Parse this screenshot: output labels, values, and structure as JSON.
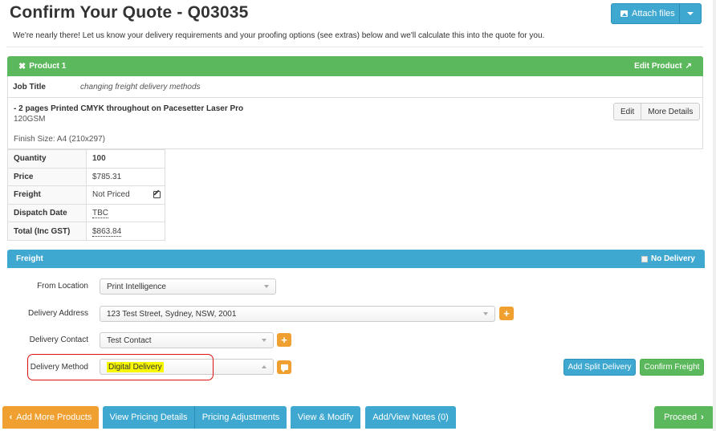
{
  "page": {
    "title": "Confirm Your Quote - Q03035",
    "intro": "We're nearly there! Let us know your delivery requirements and your proofing options (see extras) below and we'll calculate this into the quote for you.",
    "attach_label": "Attach files"
  },
  "product": {
    "header": "Product 1",
    "edit_label": "Edit Product",
    "job_title_label": "Job Title",
    "job_title_value": "changing freight delivery methods",
    "spec_title": "- 2 pages Printed CMYK throughout on Pacesetter Laser Pro",
    "spec_gsm": "120GSM",
    "finish_size": "Finish Size: A4 (210x297)",
    "edit_button": "Edit",
    "more_details_button": "More Details"
  },
  "summary": {
    "rows": [
      {
        "label": "Quantity",
        "value": "100"
      },
      {
        "label": "Price",
        "value": "$785.31"
      },
      {
        "label": "Freight",
        "value": "Not Priced"
      },
      {
        "label": "Dispatch Date",
        "value": "TBC"
      },
      {
        "label": "Total (Inc GST)",
        "value": "$863.84"
      }
    ]
  },
  "freight": {
    "header": "Freight",
    "no_delivery_label": "No Delivery",
    "from_location_label": "From Location",
    "from_location_value": "Print Intelligence",
    "delivery_address_label": "Delivery Address",
    "delivery_address_value": "123 Test Street, Sydney, NSW, 2001",
    "delivery_contact_label": "Delivery Contact",
    "delivery_contact_value": "Test Contact",
    "delivery_method_label": "Delivery Method",
    "delivery_method_value": "Digital Delivery",
    "add_split_label": "Add Split Delivery",
    "confirm_label": "Confirm Freight"
  },
  "footer": {
    "add_more_products": "Add More Products",
    "view_pricing_details": "View Pricing Details",
    "pricing_adjustments": "Pricing Adjustments",
    "view_modify": "View & Modify",
    "add_view_notes": "Add/View Notes (0)",
    "proceed": "Proceed"
  },
  "colors": {
    "green": "#5cb85c",
    "blue": "#3fa8d1",
    "orange": "#f0a030",
    "highlight": "#f7f700",
    "annotation_red": "#dd1111"
  }
}
